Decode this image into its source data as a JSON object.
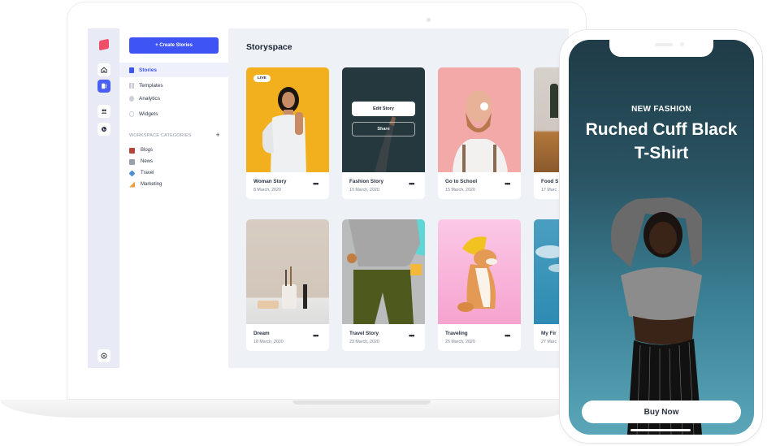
{
  "app": {
    "title": "Storyspace"
  },
  "rail": {
    "items": [
      {
        "name": "home",
        "icon": "⌂"
      },
      {
        "name": "stories",
        "icon": "▮"
      },
      {
        "name": "users",
        "icon": "👥"
      },
      {
        "name": "globe",
        "icon": "◉"
      }
    ],
    "help_icon": "?"
  },
  "nav": {
    "create_button": "+ Create Stories",
    "items": [
      {
        "label": "Stories",
        "active": true
      },
      {
        "label": "Templates"
      },
      {
        "label": "Analytics"
      },
      {
        "label": "Widgets"
      }
    ],
    "section_title": "WORKSPACE CATEGORIES",
    "section_add": "+",
    "categories": [
      {
        "label": "Blogs",
        "color": "#b5453a"
      },
      {
        "label": "News",
        "color": "#9aa0ab"
      },
      {
        "label": "Travel",
        "color": "#4a8fd6"
      },
      {
        "label": "Marketing",
        "color": "#e6a23c"
      }
    ]
  },
  "cards": [
    {
      "title": "Woman Story",
      "date": "8 March, 2020",
      "badge": "LIVE",
      "more": "•••"
    },
    {
      "title": "Fashion Story",
      "date": "10 March, 2020",
      "overlay": {
        "edit": "Edit Story",
        "share": "Share"
      },
      "more": "•••"
    },
    {
      "title": "Go to School",
      "date": "15 March, 2020",
      "more": "•••"
    },
    {
      "title": "Food S",
      "date": "17 Marc",
      "more": "•••"
    },
    {
      "title": "Dream",
      "date": "18 March, 2020",
      "more": "•••"
    },
    {
      "title": "Travel Story",
      "date": "23 March, 2020",
      "more": "•••"
    },
    {
      "title": "Traveling",
      "date": "25 March, 2020",
      "more": "•••"
    },
    {
      "title": "My Fir",
      "date": "27 Marc",
      "more": "•••"
    }
  ],
  "phone": {
    "kicker": "NEW FASHION",
    "title": "Ruched Cuff Black T-Shirt",
    "cta": "Buy Now"
  },
  "colors": {
    "accent": "#3e54f4",
    "logo": "#ee4f67"
  }
}
